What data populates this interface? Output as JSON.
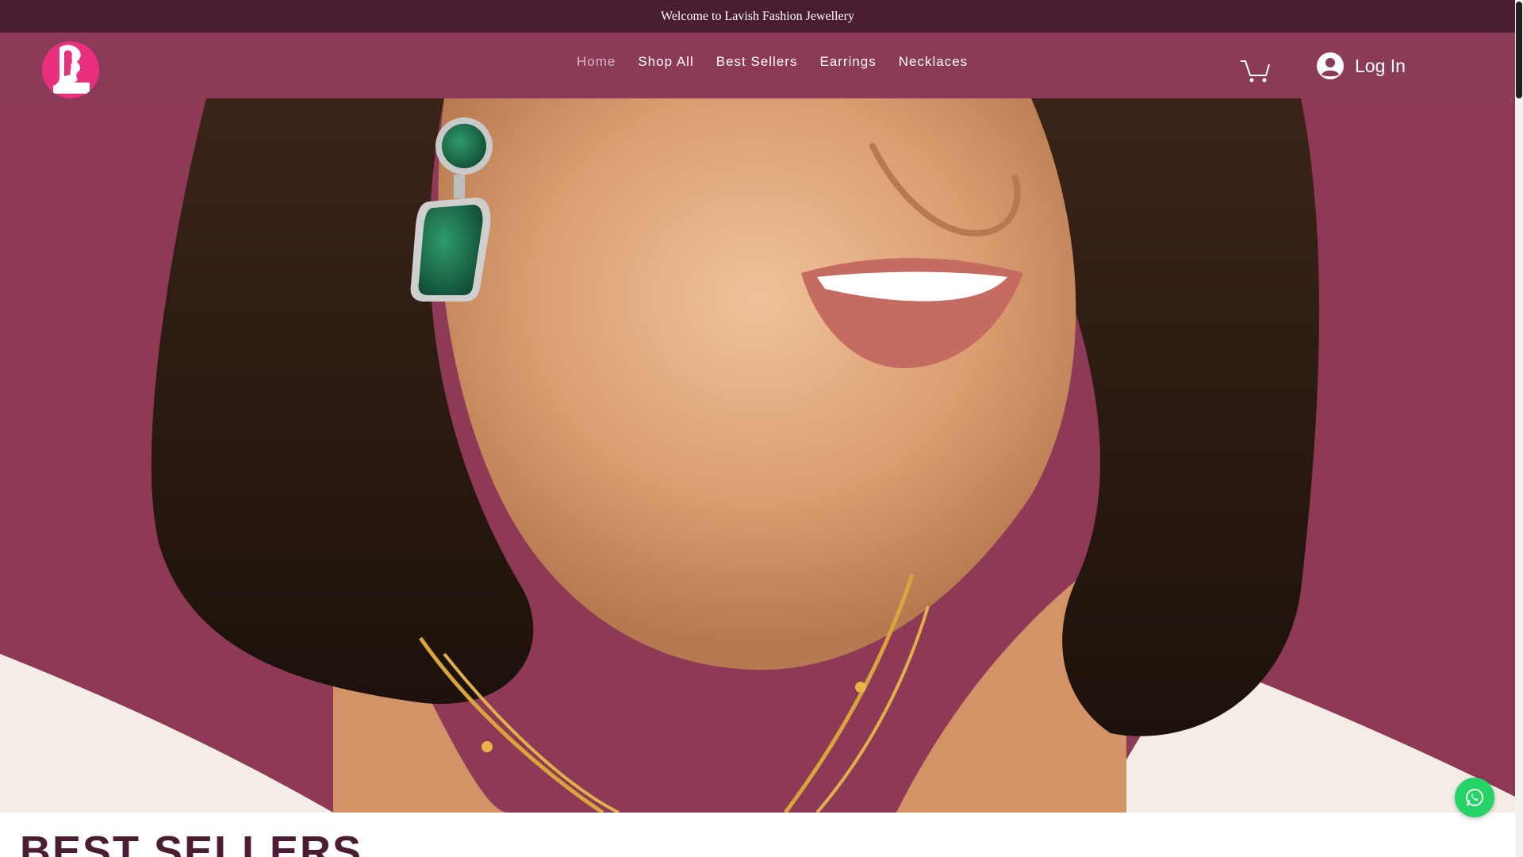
{
  "announcement": {
    "text": "Welcome to Lavish Fashion Jewellery"
  },
  "colors": {
    "announcement_bg": "#4a1d33",
    "header_bg": "#8b3a57",
    "hero_bg": "#8e3a57",
    "logo_bg": "#e8307f",
    "whatsapp": "#25d366",
    "section_title": "#4a1d33"
  },
  "header": {
    "logo_icon": "lavish-logo-icon",
    "nav": [
      {
        "label": "Home",
        "active": true
      },
      {
        "label": "Shop All",
        "active": false
      },
      {
        "label": "Best Sellers",
        "active": false
      },
      {
        "label": "Earrings",
        "active": false
      },
      {
        "label": "Necklaces",
        "active": false
      }
    ],
    "cart_icon": "cart-icon",
    "login": {
      "label": "Log In",
      "icon": "avatar-icon"
    }
  },
  "hero": {
    "image": "model-wearing-green-earrings-and-gold-necklace"
  },
  "floating": {
    "whatsapp_icon": "whatsapp-icon"
  },
  "section": {
    "title": "BEST SELLERS"
  }
}
